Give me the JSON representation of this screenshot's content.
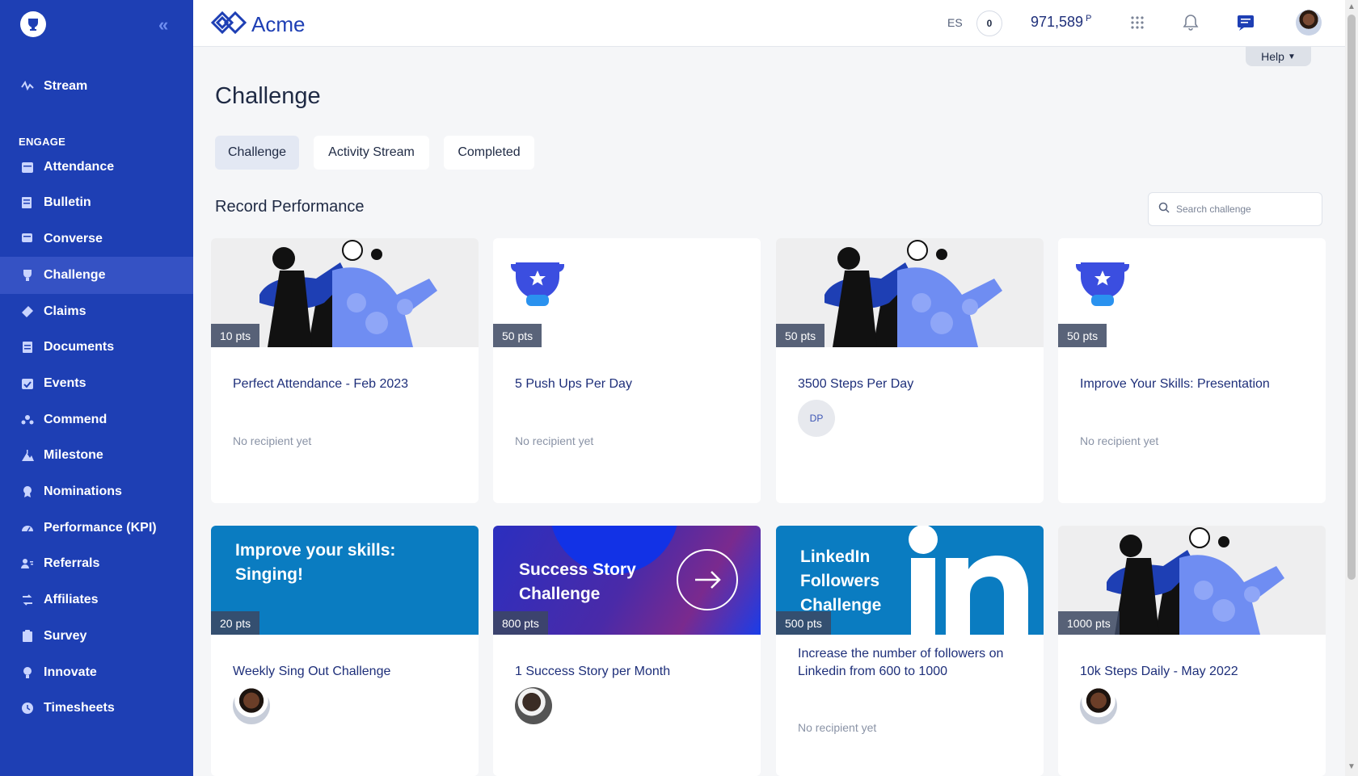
{
  "sidebar": {
    "section_label": "ENGAGE",
    "items": [
      {
        "label": "Stream",
        "icon": "stream-icon"
      },
      {
        "label": "Attendance",
        "icon": "calendar-icon"
      },
      {
        "label": "Bulletin",
        "icon": "bulletin-icon"
      },
      {
        "label": "Converse",
        "icon": "chat-icon"
      },
      {
        "label": "Challenge",
        "icon": "trophy-icon"
      },
      {
        "label": "Claims",
        "icon": "tag-icon"
      },
      {
        "label": "Documents",
        "icon": "document-icon"
      },
      {
        "label": "Events",
        "icon": "event-icon"
      },
      {
        "label": "Commend",
        "icon": "commend-icon"
      },
      {
        "label": "Milestone",
        "icon": "milestone-icon"
      },
      {
        "label": "Nominations",
        "icon": "award-icon"
      },
      {
        "label": "Performance (KPI)",
        "icon": "gauge-icon"
      },
      {
        "label": "Referrals",
        "icon": "referral-icon"
      },
      {
        "label": "Affiliates",
        "icon": "affiliates-icon"
      },
      {
        "label": "Survey",
        "icon": "survey-icon"
      },
      {
        "label": "Innovate",
        "icon": "lightbulb-icon"
      },
      {
        "label": "Timesheets",
        "icon": "clock-icon"
      }
    ],
    "active": "Challenge"
  },
  "topbar": {
    "brand": "Acme",
    "language": "ES",
    "badge_count": "0",
    "points": "971,589",
    "points_unit": "P",
    "help": "Help"
  },
  "main": {
    "title": "Challenge",
    "tabs": [
      {
        "label": "Challenge",
        "active": true
      },
      {
        "label": "Activity Stream",
        "active": false
      },
      {
        "label": "Completed",
        "active": false
      }
    ],
    "section_title": "Record Performance",
    "search_placeholder": "Search challenge"
  },
  "cards": [
    {
      "title": "Perfect Attendance - Feb 2023",
      "points": "10 pts",
      "recipient": "No recipient yet",
      "image": "illustration"
    },
    {
      "title": "5 Push Ups Per Day",
      "points": "50 pts",
      "recipient": "No recipient yet",
      "image": "trophy"
    },
    {
      "title": "3500 Steps Per Day",
      "points": "50 pts",
      "initials": "DP",
      "image": "illustration"
    },
    {
      "title": "Improve Your Skills: Presentation",
      "points": "50 pts",
      "recipient": "No recipient yet",
      "image": "trophy"
    },
    {
      "title": "Weekly Sing Out Challenge",
      "points": "20 pts",
      "banner": "Improve your skills: Singing!",
      "image": "banner-blue"
    },
    {
      "title": "1 Success Story per Month",
      "points": "800 pts",
      "banner": "Success Story Challenge",
      "image": "banner-gradient"
    },
    {
      "title": "Increase the number of followers on Linkedin from 600 to 1000",
      "points": "500 pts",
      "banner": "LinkedIn Followers Challenge",
      "recipient": "No recipient yet",
      "image": "banner-linkedin"
    },
    {
      "title": "10k Steps Daily - May 2022",
      "points": "1000 pts",
      "image": "illustration"
    }
  ],
  "colors": {
    "sidebar": "#1e3fb4",
    "accent": "#1e2f7a",
    "linkedin": "#0a7cc1"
  }
}
